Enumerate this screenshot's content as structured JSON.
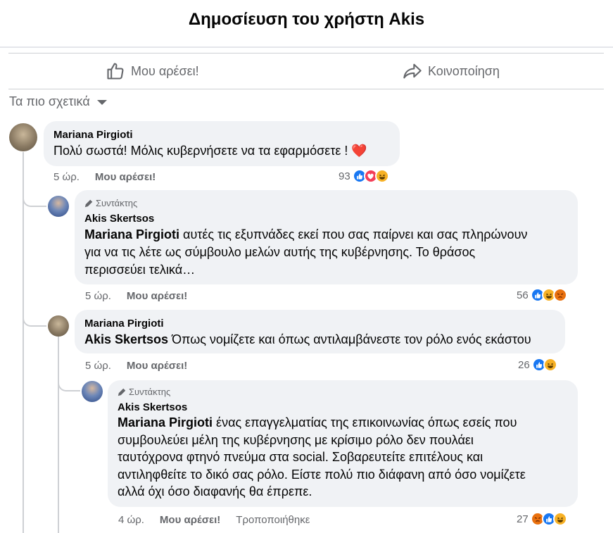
{
  "header": {
    "title": "Δημοσίευση του χρήστη Akis"
  },
  "actions": {
    "like_label": "Μου αρέσει!",
    "share_label": "Κοινοποίηση"
  },
  "sort": {
    "label": "Τα πιο σχετικά"
  },
  "comments": [
    {
      "author": "Mariana Pirgioti",
      "text": "Πολύ σωστά! Μόλις κυβερνήσετε να τα εφαρμόσετε ! ❤️",
      "time": "5 ώρ.",
      "like_label": "Μου αρέσει!",
      "reaction_count": "93",
      "reactions": [
        "like-icon",
        "love-icon",
        "haha-icon"
      ]
    },
    {
      "badge": "Συντάκτης",
      "author": "Akis Skertsos",
      "mention": "Mariana Pirgioti",
      "lines": [
        "αυτές τις εξυπνάδες εκεί που σας παίρνει και σας πληρώνουν",
        "για να τις λέτε ως σύμβουλο μελών αυτής της κυβέρνησης. Το θράσος",
        "περισσεύει τελικά…"
      ],
      "time": "5 ώρ.",
      "like_label": "Μου αρέσει!",
      "reaction_count": "56",
      "reactions": [
        "like-icon",
        "haha-icon",
        "angry-icon"
      ]
    },
    {
      "author": "Mariana Pirgioti",
      "mention": "Akis Skertsos",
      "text": "Όπως νομίζετε και όπως αντιλαμβάνεστε τον ρόλο ενός εκάστου",
      "time": "5 ώρ.",
      "like_label": "Μου αρέσει!",
      "reaction_count": "26",
      "reactions": [
        "like-icon",
        "haha-icon"
      ]
    },
    {
      "badge": "Συντάκτης",
      "author": "Akis Skertsos",
      "mention": "Mariana Pirgioti",
      "lines": [
        "ένας επαγγελματίας της επικοινωνίας όπως εσείς που",
        "συμβουλεύει μέλη της κυβέρνησης με κρίσιμο ρόλο δεν πουλάει",
        "ταυτόχρονα φτηνό πνεύμα στα social. Σοβαρευτείτε επιτέλους και",
        "αντιληφθείτε το δικό σας ρόλο. Είστε πολύ πιο διάφανη από όσο νομίζετε",
        "αλλά όχι όσο διαφανής θα έπρεπε."
      ],
      "time": "4 ώρ.",
      "like_label": "Μου αρέσει!",
      "edited": "Τροποποιήθηκε",
      "reaction_count": "27",
      "reactions": [
        "angry-icon",
        "like-icon",
        "haha-icon"
      ]
    }
  ],
  "colors": {
    "like_blue": "#1877f2",
    "love_red": "#f33e58",
    "haha_yellow": "#f7b125",
    "angry_orange": "#e9710f",
    "bubble_bg": "#f0f2f5",
    "muted_text": "#65676b"
  }
}
